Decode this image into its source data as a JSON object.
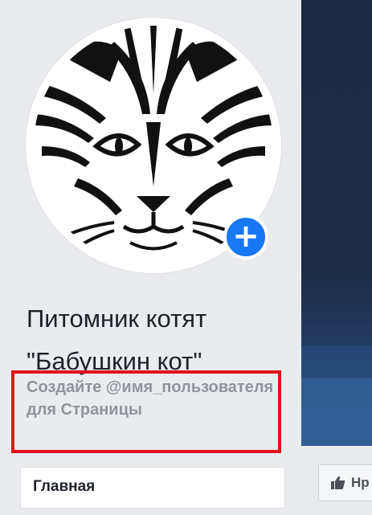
{
  "page": {
    "title_line1": "Питомник котят",
    "title_line2": "\"Бабушкин кот\"",
    "username_prompt": "Создайте @имя_пользователя для Страницы"
  },
  "nav": {
    "tabs": [
      "Главная"
    ]
  },
  "actions": {
    "like_label": "Нр"
  },
  "colors": {
    "accent": "#1877f2",
    "highlight_box": "#e0121b",
    "muted_text": "#90949c",
    "background": "#e9ebee"
  },
  "icons": {
    "add_photo": "plus-icon",
    "like": "thumbs-up-icon"
  }
}
